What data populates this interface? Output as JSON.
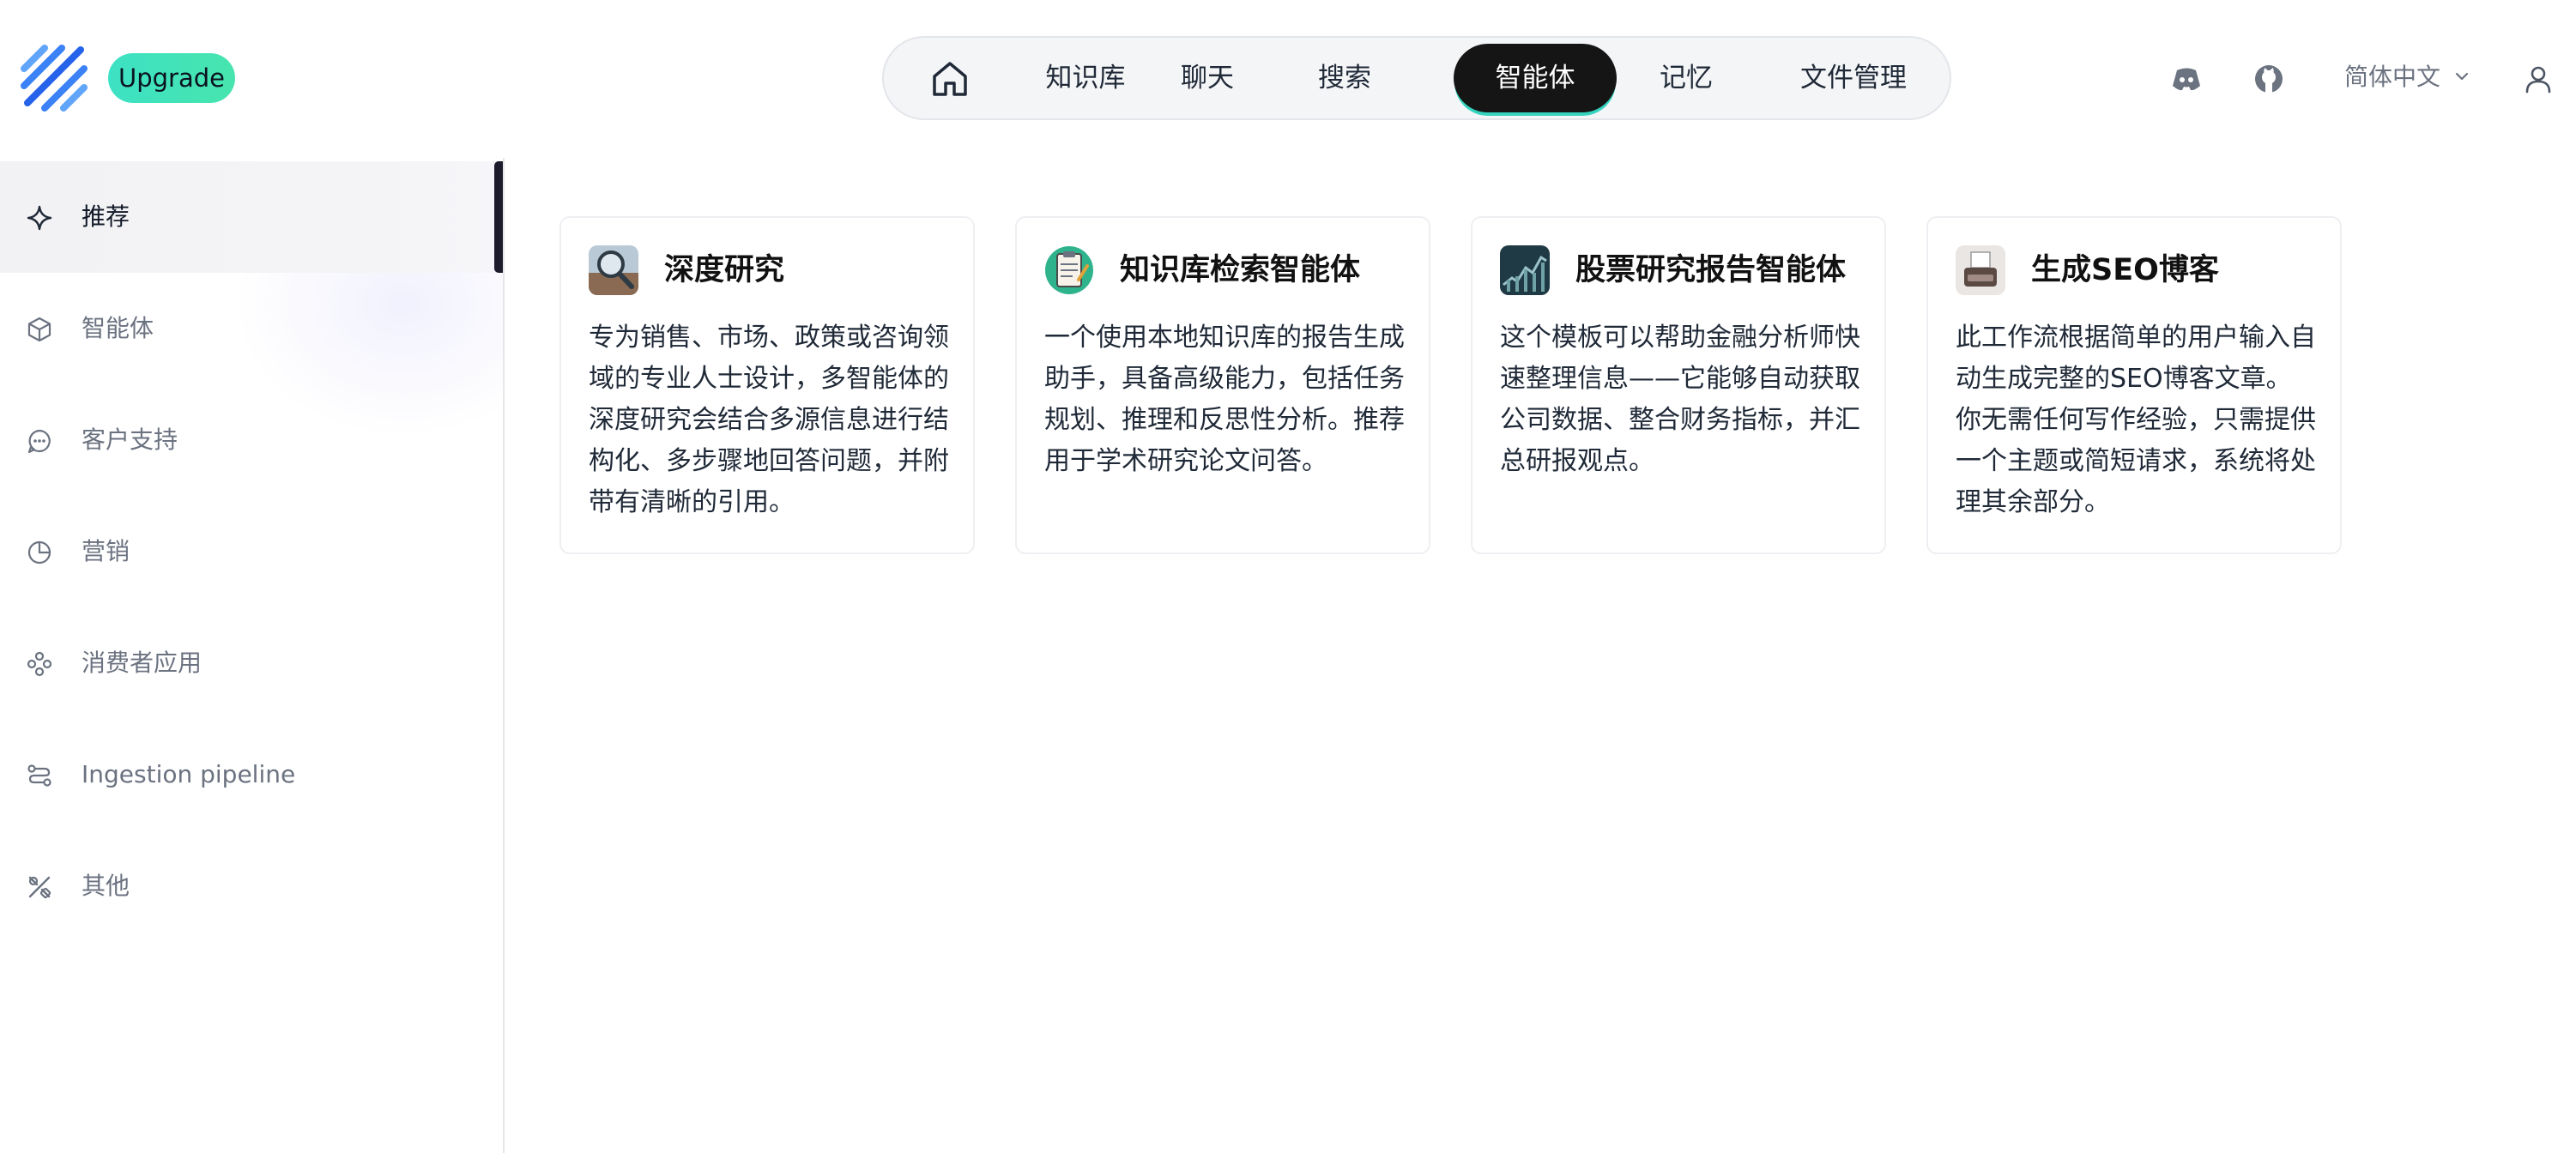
{
  "header": {
    "upgrade_label": "Upgrade",
    "nav": [
      {
        "label": "知识库"
      },
      {
        "label": "聊天"
      },
      {
        "label": "搜索"
      },
      {
        "label": "智能体",
        "active": true
      },
      {
        "label": "记忆"
      },
      {
        "label": "文件管理"
      }
    ],
    "language": "简体中文",
    "icons": [
      "logo-icon",
      "home-icon",
      "discord-icon",
      "github-icon",
      "chevron-down-icon",
      "user-icon"
    ]
  },
  "sidebar": {
    "items": [
      {
        "label": "推荐",
        "icon": "sparkle-icon",
        "active": true
      },
      {
        "label": "智能体",
        "icon": "cube-icon"
      },
      {
        "label": "客户支持",
        "icon": "chat-icon"
      },
      {
        "label": "营销",
        "icon": "pie-chart-icon"
      },
      {
        "label": "消费者应用",
        "icon": "apps-icon"
      },
      {
        "label": "Ingestion pipeline",
        "icon": "pipeline-icon"
      },
      {
        "label": "其他",
        "icon": "tools-icon"
      }
    ]
  },
  "cards": [
    {
      "title": "深度研究",
      "description": "专为销售、市场、政策或咨询领域的专业人士设计，多智能体的深度研究会结合多源信息进行结构化、多步骤地回答问题，并附带有清晰的引用。"
    },
    {
      "title": "知识库检索智能体",
      "description": "一个使用本地知识库的报告生成助手，具备高级能力，包括任务规划、推理和反思性分析。推荐用于学术研究论文问答。"
    },
    {
      "title": "股票研究报告智能体",
      "description": "这个模板可以帮助金融分析师快速整理信息——它能够自动获取公司数据、整合财务指标，并汇总研报观点。"
    },
    {
      "title": "生成SEO博客",
      "description": "此工作流根据简单的用户输入自动生成完整的SEO博客文章。你无需任何写作经验，只需提供一个主题或简短请求，系统将处理其余部分。"
    }
  ],
  "colors": {
    "accent": "#36d4bf",
    "upgrade_start": "#3de2c4",
    "upgrade_end": "#47e4ad",
    "active_nav": "#151515",
    "logo_blue": "#3b82f6"
  }
}
